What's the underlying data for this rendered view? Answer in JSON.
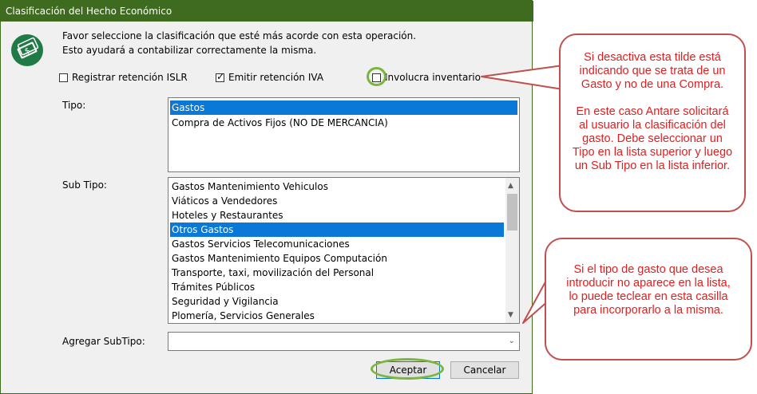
{
  "window": {
    "title": "Clasificación del Hecho Económico"
  },
  "header": {
    "line1": "Favor seleccione la clasificación que esté más acorde con esta operación.",
    "line2": "Esto ayudará a contabilizar correctamente la misma.",
    "icon": "money-icon"
  },
  "checkboxes": [
    {
      "label": "Registrar retención ISLR",
      "checked": false
    },
    {
      "label": "Emitir retención IVA",
      "checked": true
    },
    {
      "label": "Involucra inventario",
      "checked": false
    }
  ],
  "tipo": {
    "label": "Tipo:",
    "items": [
      "Gastos",
      "Compra de Activos Fijos (NO DE MERCANCIA)"
    ],
    "selected": "Gastos"
  },
  "subtipo": {
    "label": "Sub Tipo:",
    "items": [
      "Gastos Mantenimiento Vehiculos",
      "Viáticos a Vendedores",
      "Hoteles y Restaurantes",
      "Otros Gastos",
      "Gastos Servicios Telecomunicaciones",
      "Gastos Mantenimiento Equipos Computación",
      "Transporte, taxi, movilización del Personal",
      "Trámites Públicos",
      "Seguridad y Vigilancia",
      "Plomería, Servicios Generales"
    ],
    "selected": "Otros Gastos"
  },
  "agregar": {
    "label": "Agregar SubTipo:",
    "value": ""
  },
  "buttons": {
    "accept": "Aceptar",
    "cancel": "Cancelar"
  },
  "callouts": {
    "top_para1": "Si desactiva esta tilde está indicando que se trata de un Gasto y no de una Compra.",
    "top_para2": "En este caso Antare solicitará al usuario la clasificación del gasto. Debe seleccionar un Tipo en la lista superior y luego un Sub Tipo en la lista inferior.",
    "bottom": "Si el tipo de gasto que desea introducir no aparece en la lista, lo puede teclear en esta casilla para incorporarlo a la misma."
  },
  "colors": {
    "titlebar": "#3f6b21",
    "selection": "#0a78d7",
    "callout_text": "#e02020",
    "callout_border": "#c0504d",
    "highlight_ring": "#7bb53a"
  }
}
